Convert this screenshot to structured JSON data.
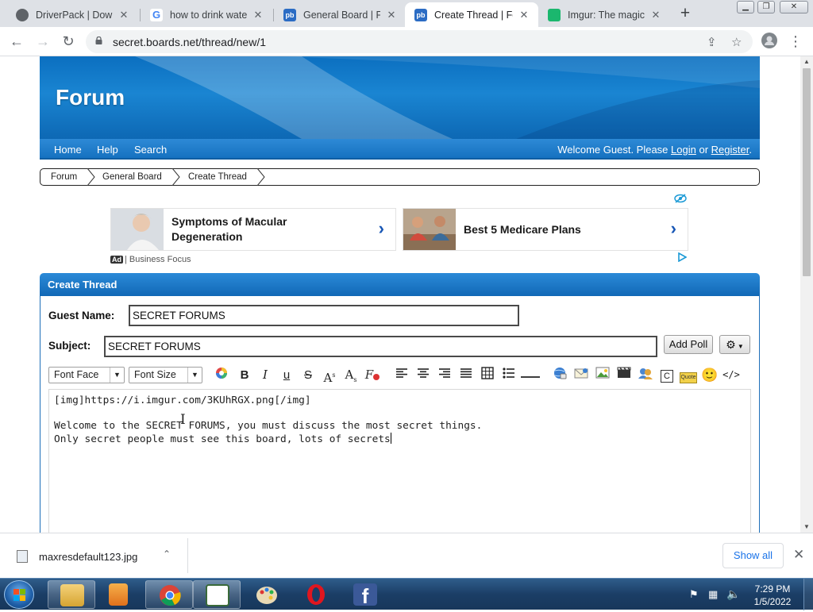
{
  "browser": {
    "tabs": [
      {
        "title": "DriverPack | Downl",
        "icon": "driverpack-favicon",
        "active": false
      },
      {
        "title": "how to drink water",
        "icon": "google-favicon",
        "active": false
      },
      {
        "title": "General Board | For",
        "icon": "proboards-favicon",
        "active": false
      },
      {
        "title": "Create Thread | For",
        "icon": "proboards-favicon",
        "active": true
      },
      {
        "title": "Imgur: The magic o",
        "icon": "imgur-favicon",
        "active": false
      }
    ],
    "url": "secret.boards.net/thread/new/1"
  },
  "site": {
    "title": "Forum",
    "nav": {
      "home": "Home",
      "help": "Help",
      "search": "Search"
    },
    "welcome": {
      "prefix": "Welcome Guest. Please",
      "login": "Login",
      "or": "or",
      "register": "Register",
      "suffix": "."
    },
    "breadcrumb": [
      "Forum",
      "General Board",
      "Create Thread"
    ]
  },
  "ads": {
    "cards": [
      {
        "title": "Symptoms of Macular Degeneration"
      },
      {
        "title": "Best 5 Medicare Plans"
      }
    ],
    "badge": "Ad",
    "source": "| Business Focus"
  },
  "form": {
    "panel_title": "Create Thread",
    "guest_name_label": "Guest Name:",
    "guest_name_value": "SECRET FORUMS",
    "subject_label": "Subject:",
    "subject_value": "SECRET FORUMS",
    "add_poll": "Add Poll",
    "font_face": "Font Face",
    "font_size": "Font Size",
    "editor_lines": [
      "[img]https://i.imgur.com/3KUhRGX.png[/img]",
      "",
      "Welcome to the SECRET FORUMS, you must discuss the most secret things.",
      "Only secret people must see this board, lots of secrets"
    ]
  },
  "downloads": {
    "filename": "maxresdefault123.jpg",
    "show_all": "Show all"
  },
  "taskbar": {
    "time": "7:29 PM",
    "date": "1/5/2022"
  },
  "colors": {
    "forum_blue": "#1672c0",
    "link_blue": "#1a73e8",
    "ad_arrow": "#1756b5"
  }
}
